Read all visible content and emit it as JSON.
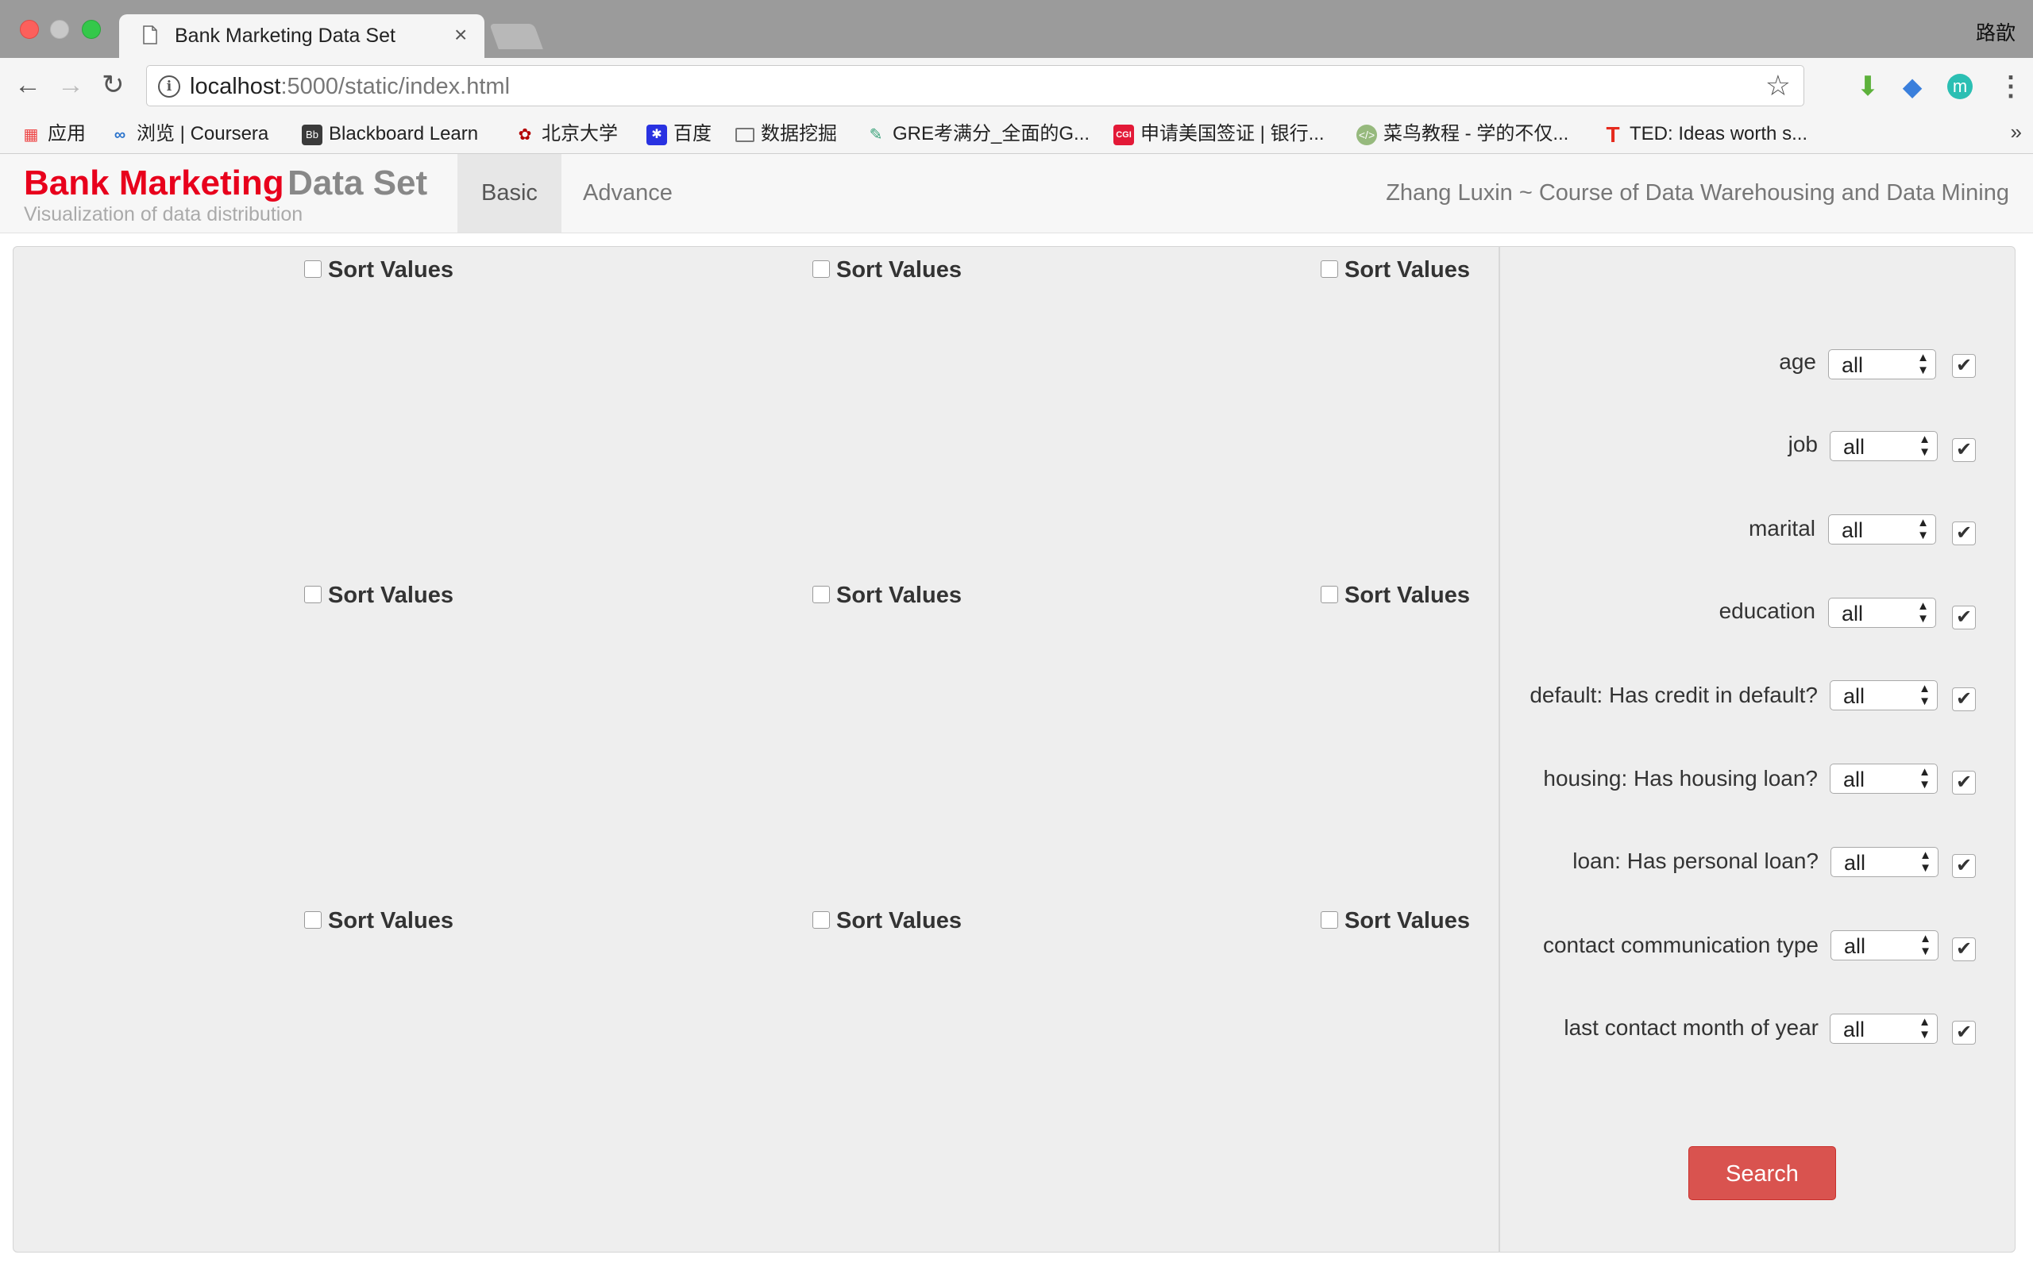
{
  "browser": {
    "tab_title": "Bank Marketing Data Set",
    "tab_close": "×",
    "user_name": "路歆",
    "url_host": "localhost",
    "url_path": ":5000/static/index.html",
    "bookmarks": [
      {
        "label": "应用",
        "icon": "apps-grid-icon"
      },
      {
        "label": "浏览 | Coursera",
        "icon": "coursera-icon"
      },
      {
        "label": "Blackboard Learn",
        "icon": "blackboard-icon"
      },
      {
        "label": "北京大学",
        "icon": "pku-icon"
      },
      {
        "label": "百度",
        "icon": "baidu-paw-icon"
      },
      {
        "label": "数据挖掘",
        "icon": "folder-icon"
      },
      {
        "label": "GRE考满分_全面的G...",
        "icon": "kmf-icon"
      },
      {
        "label": "申请美国签证 | 银行...",
        "icon": "cgi-icon"
      },
      {
        "label": "菜鸟教程 - 学的不仅...",
        "icon": "runoob-icon"
      },
      {
        "label": "TED: Ideas worth s...",
        "icon": "ted-icon"
      }
    ],
    "bookmarks_more": "»"
  },
  "header": {
    "brand_red": "Bank Marketing",
    "brand_gray": "Data Set",
    "subtitle": "Visualization of data distribution",
    "tabs": [
      {
        "label": "Basic",
        "active": true
      },
      {
        "label": "Advance",
        "active": false
      }
    ],
    "credit": "Zhang Luxin ~ Course of Data Warehousing and Data Mining"
  },
  "charts": {
    "sort_label": "Sort Values",
    "sort_checked": [
      false,
      false,
      false,
      false,
      false,
      false,
      false,
      false,
      false
    ]
  },
  "filters": [
    {
      "label": "age",
      "value": "all",
      "checked": true
    },
    {
      "label": "job",
      "value": "all",
      "checked": true
    },
    {
      "label": "marital",
      "value": "all",
      "checked": true
    },
    {
      "label": "education",
      "value": "all",
      "checked": true
    },
    {
      "label": "default: Has credit in default?",
      "value": "all",
      "checked": true
    },
    {
      "label": "housing: Has housing loan?",
      "value": "all",
      "checked": true
    },
    {
      "label": "loan: Has personal loan?",
      "value": "all",
      "checked": true
    },
    {
      "label": "contact communication type",
      "value": "all",
      "checked": true
    },
    {
      "label": "last contact month of year",
      "value": "all",
      "checked": true
    }
  ],
  "search_label": "Search",
  "colors": {
    "brand_red": "#e8001c",
    "search_button": "#d9534f"
  }
}
